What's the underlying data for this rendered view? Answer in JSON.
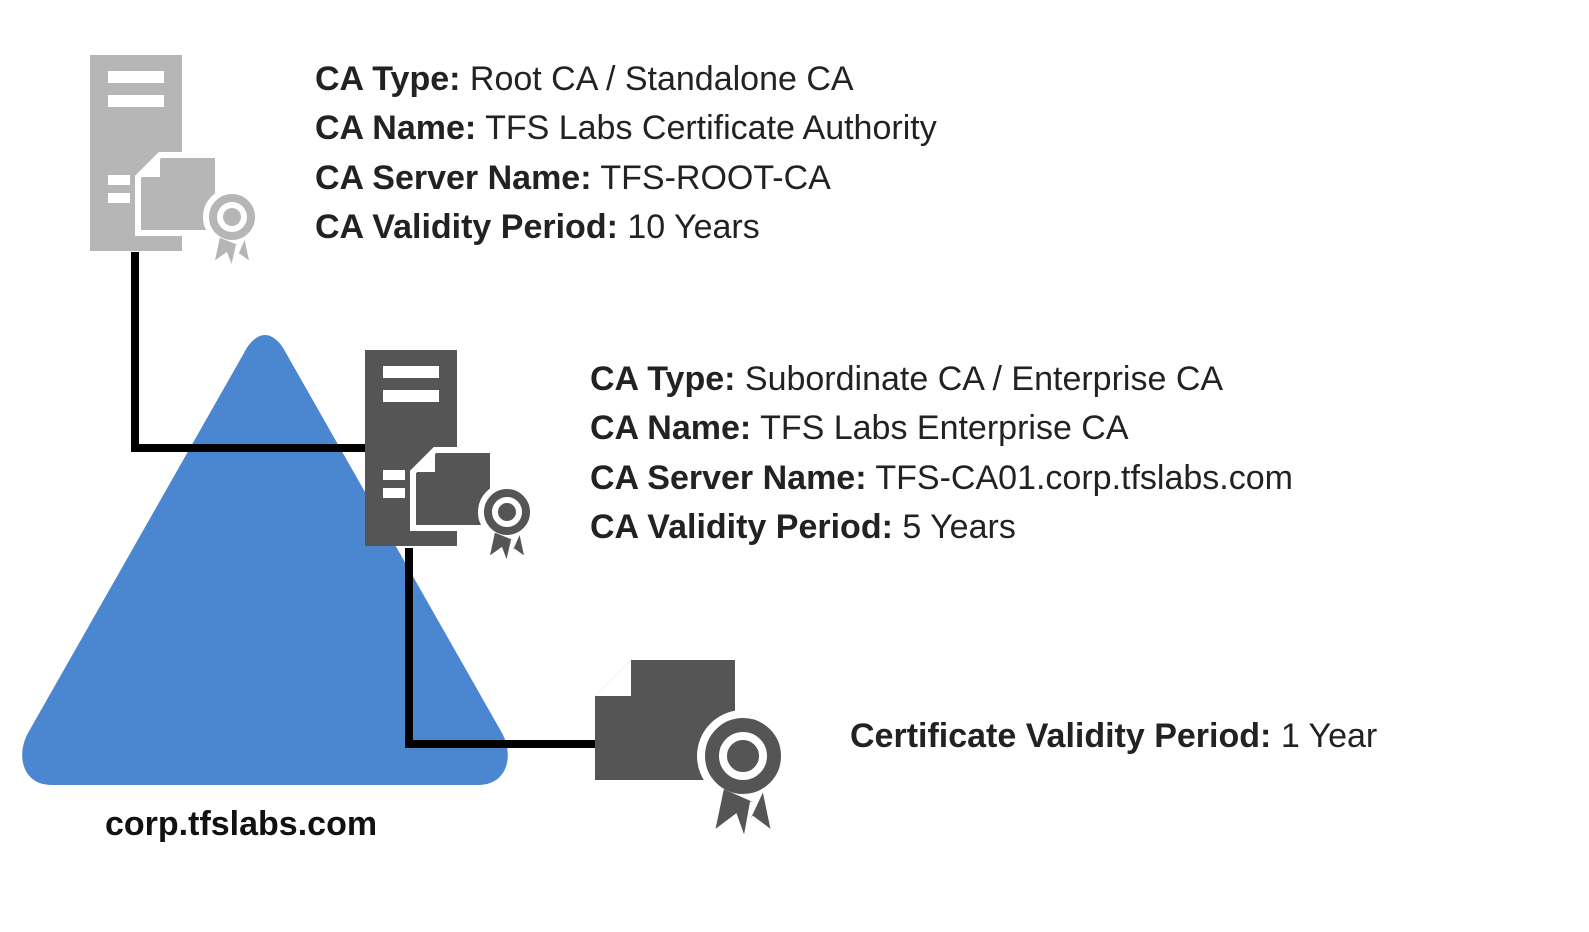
{
  "domain_label": "corp.tfslabs.com",
  "root": {
    "type_label": "CA Type:",
    "type_value": "Root CA / Standalone CA",
    "name_label": "CA Name:",
    "name_value": "TFS Labs Certificate Authority",
    "server_label": "CA Server Name:",
    "server_value": "TFS-ROOT-CA",
    "validity_label": "CA Validity Period:",
    "validity_value": "10 Years"
  },
  "sub": {
    "type_label": "CA Type:",
    "type_value": "Subordinate CA / Enterprise CA",
    "name_label": "CA Name:",
    "name_value": "TFS Labs Enterprise CA",
    "server_label": "CA Server Name:",
    "server_value": "TFS-CA01.corp.tfslabs.com",
    "validity_label": "CA Validity Period:",
    "validity_value": "5 Years"
  },
  "leaf": {
    "validity_label": "Certificate Validity Period:",
    "validity_value": "1 Year"
  },
  "colors": {
    "triangle": "#4B86D0",
    "root_icon": "#B6B6B6",
    "sub_icon": "#555555",
    "leaf_icon": "#555555"
  }
}
